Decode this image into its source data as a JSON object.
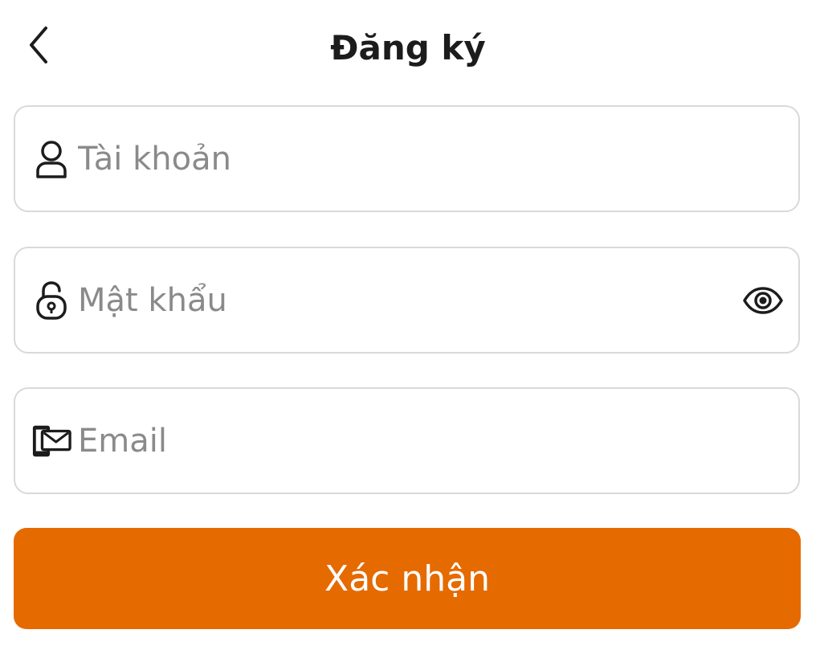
{
  "header": {
    "title": "Đăng ký",
    "back_icon": "chevron-left-icon"
  },
  "form": {
    "username": {
      "placeholder": "Tài khoản",
      "value": "",
      "icon": "user-icon"
    },
    "password": {
      "placeholder": "Mật khẩu",
      "value": "",
      "icon": "lock-icon",
      "toggle_icon": "eye-icon"
    },
    "email": {
      "placeholder": "Email",
      "value": "",
      "icon": "phone-mail-icon"
    },
    "submit_label": "Xác nhận"
  },
  "colors": {
    "accent": "#e56a00",
    "border": "#d9d9d9",
    "placeholder": "#8a8a8a",
    "text": "#1c1c1c"
  }
}
